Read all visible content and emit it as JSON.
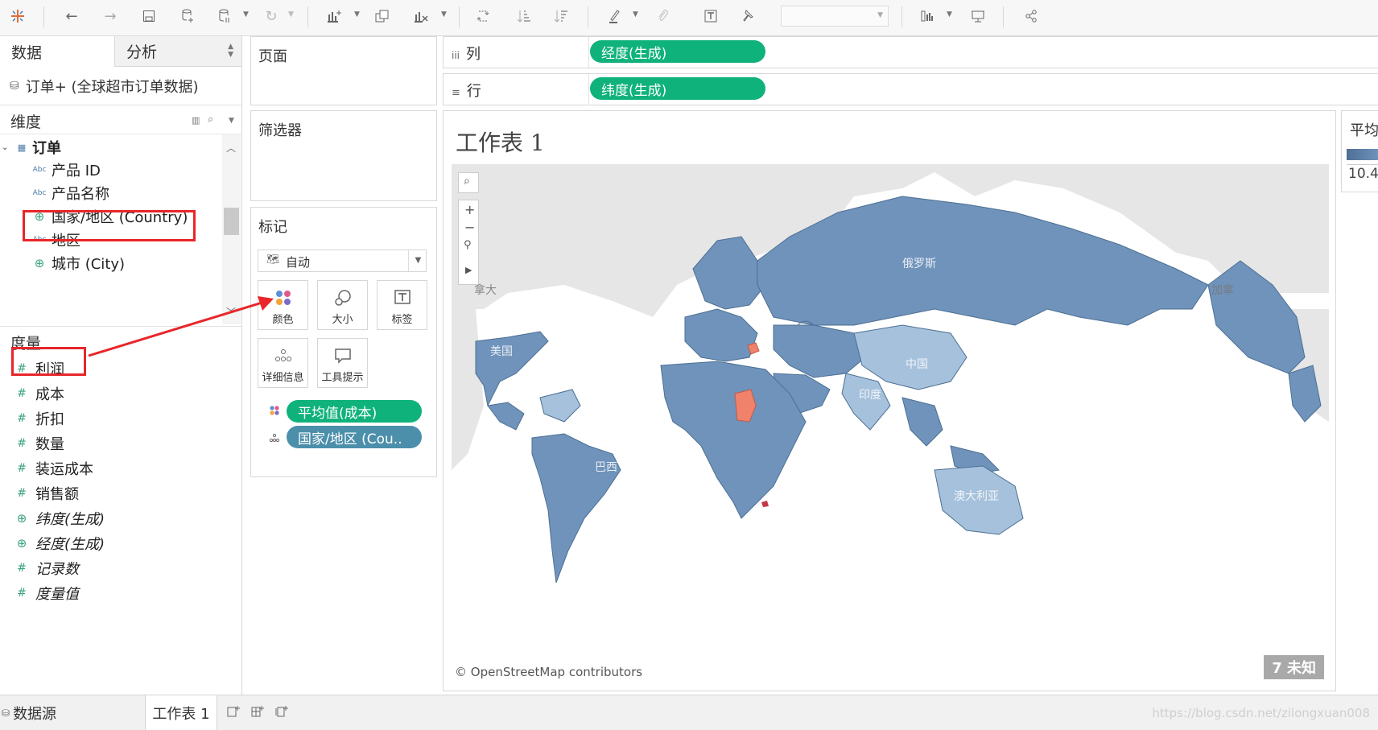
{
  "toolbar": {
    "icons": [
      "tableau-logo-icon",
      "undo-icon",
      "redo-icon",
      "save-icon",
      "new-datasource-icon",
      "pause-updates-icon",
      "refresh-icon",
      "new-worksheet-icon",
      "duplicate-icon",
      "clear-sheet-icon",
      "swap-icon",
      "sort-ascending-icon",
      "sort-descending-icon",
      "highlight-icon",
      "group-icon",
      "label-icon",
      "pin-icon",
      "show-cards-icon",
      "presentation-icon",
      "share-icon"
    ],
    "fit_dropdown_value": ""
  },
  "left_panel": {
    "tab_data": "数据",
    "tab_analysis": "分析",
    "datasource": "订单+ (全球超市订单数据)",
    "dimensions_title": "维度",
    "dimension_group": "订单",
    "dimensions": [
      {
        "icon": "string-icon",
        "label": "产品 ID"
      },
      {
        "icon": "string-icon",
        "label": "产品名称"
      },
      {
        "icon": "globe-icon",
        "label": "国家/地区 (Country)"
      },
      {
        "icon": "string-icon",
        "label": "地区"
      },
      {
        "icon": "globe-icon",
        "label": "城市 (City)"
      }
    ],
    "measures_title": "度量",
    "measures": [
      {
        "icon": "number-icon",
        "label": "利润"
      },
      {
        "icon": "number-icon",
        "label": "成本"
      },
      {
        "icon": "number-icon",
        "label": "折扣"
      },
      {
        "icon": "number-icon",
        "label": "数量"
      },
      {
        "icon": "number-icon",
        "label": "装运成本"
      },
      {
        "icon": "number-icon",
        "label": "销售额"
      },
      {
        "icon": "globe-icon",
        "label": "纬度(生成)"
      },
      {
        "icon": "globe-icon",
        "label": "经度(生成)"
      },
      {
        "icon": "number-icon",
        "label": "记录数"
      },
      {
        "icon": "number-icon",
        "label": "度量值"
      }
    ]
  },
  "cards": {
    "pages": "页面",
    "filters": "筛选器",
    "marks": "标记",
    "mark_type": "自动",
    "mark_buttons": [
      "颜色",
      "大小",
      "标签",
      "详细信息",
      "工具提示"
    ],
    "mark_pills": [
      "平均值(成本)",
      "国家/地区 (Cou.."
    ]
  },
  "shelves": {
    "columns_label": "列",
    "columns_pill": "经度(生成)",
    "rows_label": "行",
    "rows_pill": "纬度(生成)"
  },
  "view": {
    "sheet_title": "工作表 1",
    "map_labels": [
      "俄罗斯",
      "加拿",
      "美国",
      "中国",
      "印度",
      "巴西",
      "澳大利亚",
      "拿大"
    ],
    "attribution": "© OpenStreetMap contributors",
    "unknown_badge": "7 未知",
    "colors": {
      "country_fill": "#6f93bb",
      "light_fill": "#a6c1dc",
      "highlight": "#f0826b",
      "ocean": "#ffffff"
    }
  },
  "legend": {
    "title": "平均",
    "value": "10.4"
  },
  "bottom": {
    "datasource_tab": "数据源",
    "sheet_tab": "工作表 1",
    "watermark": "https://blog.csdn.net/zilongxuan008"
  }
}
